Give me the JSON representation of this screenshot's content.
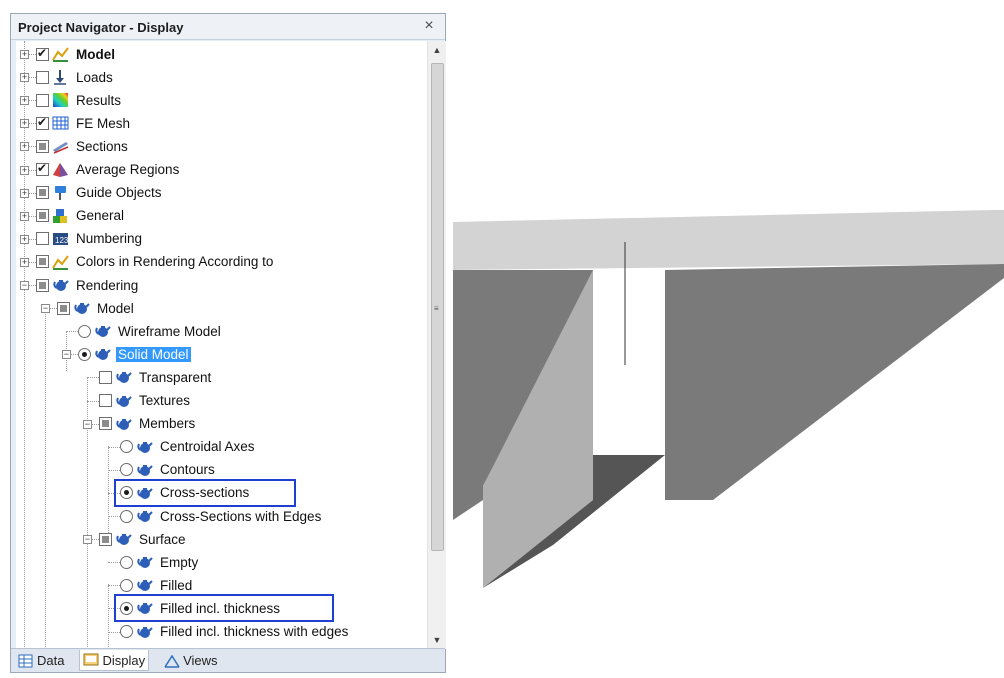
{
  "panel": {
    "title": "Project Navigator - Display",
    "close_glyph": "×"
  },
  "tree": [
    {
      "label": "Model",
      "check": "checked",
      "icon": "model-icon",
      "bold": true
    },
    {
      "label": "Loads",
      "check": "unchecked",
      "icon": "loads-icon"
    },
    {
      "label": "Results",
      "check": "unchecked",
      "icon": "results-icon"
    },
    {
      "label": "FE Mesh",
      "check": "checked",
      "icon": "fe-mesh-icon"
    },
    {
      "label": "Sections",
      "check": "partial",
      "icon": "sections-icon"
    },
    {
      "label": "Average Regions",
      "check": "checked",
      "icon": "average-regions-icon"
    },
    {
      "label": "Guide Objects",
      "check": "partial",
      "icon": "guide-objects-icon"
    },
    {
      "label": "General",
      "check": "partial",
      "icon": "general-icon"
    },
    {
      "label": "Numbering",
      "check": "unchecked",
      "icon": "numbering-icon"
    },
    {
      "label": "Colors in Rendering According to",
      "check": "partial",
      "icon": "colors-icon"
    },
    {
      "label": "Rendering",
      "check": "partial",
      "icon": "teapot-icon"
    },
    {
      "label": "Model",
      "check": "partial",
      "icon": "teapot-icon"
    },
    {
      "label": "Wireframe Model",
      "radio": "unchecked",
      "icon": "teapot-icon"
    },
    {
      "label": "Solid Model",
      "radio": "checked",
      "icon": "teapot-icon",
      "selected": true
    },
    {
      "label": "Transparent",
      "check": "unchecked",
      "icon": "teapot-icon"
    },
    {
      "label": "Textures",
      "check": "unchecked",
      "icon": "teapot-icon"
    },
    {
      "label": "Members",
      "check": "partial",
      "icon": "teapot-icon"
    },
    {
      "label": "Centroidal Axes",
      "radio": "unchecked",
      "icon": "teapot-icon"
    },
    {
      "label": "Contours",
      "radio": "unchecked",
      "icon": "teapot-icon"
    },
    {
      "label": "Cross-sections",
      "radio": "checked",
      "icon": "teapot-icon"
    },
    {
      "label": "Cross-Sections with Edges",
      "radio": "unchecked",
      "icon": "teapot-icon"
    },
    {
      "label": "Surface",
      "check": "partial",
      "icon": "teapot-icon"
    },
    {
      "label": "Empty",
      "radio": "unchecked",
      "icon": "teapot-icon"
    },
    {
      "label": "Filled",
      "radio": "unchecked",
      "icon": "teapot-icon"
    },
    {
      "label": "Filled incl. thickness",
      "radio": "checked",
      "icon": "teapot-icon"
    },
    {
      "label": "Filled incl. thickness with edges",
      "radio": "unchecked",
      "icon": "teapot-icon"
    }
  ],
  "tabs": [
    {
      "label": "Data",
      "icon": "data-icon"
    },
    {
      "label": "Display",
      "icon": "display-icon",
      "active": true
    },
    {
      "label": "Views",
      "icon": "views-icon"
    }
  ],
  "colors": {
    "highlight_box": "#1f3fd0",
    "selection": "#3399ff",
    "slab_top": "#d3d3d3",
    "slab_side": "#b3b3b3",
    "slab_bottom": "#7a7a7a",
    "beam_side": "#b0b0b0",
    "beam_face": "#ffffff",
    "beam_bottom": "#5a5a5a"
  }
}
